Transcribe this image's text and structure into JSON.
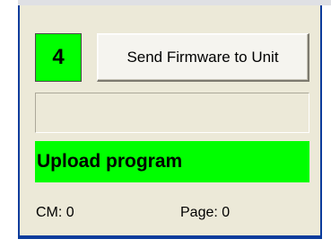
{
  "step": {
    "number": "4"
  },
  "send_button": {
    "label": "Send Firmware to Unit"
  },
  "progress": {
    "value_percent": 0
  },
  "status": {
    "text": "Upload program"
  },
  "counters": {
    "cm_text": "CM: 0",
    "page_text": "Page: 0"
  },
  "colors": {
    "accent_green": "#00ff00",
    "panel_bg": "#ece9d8",
    "border_blue": "#0a3c9c"
  }
}
